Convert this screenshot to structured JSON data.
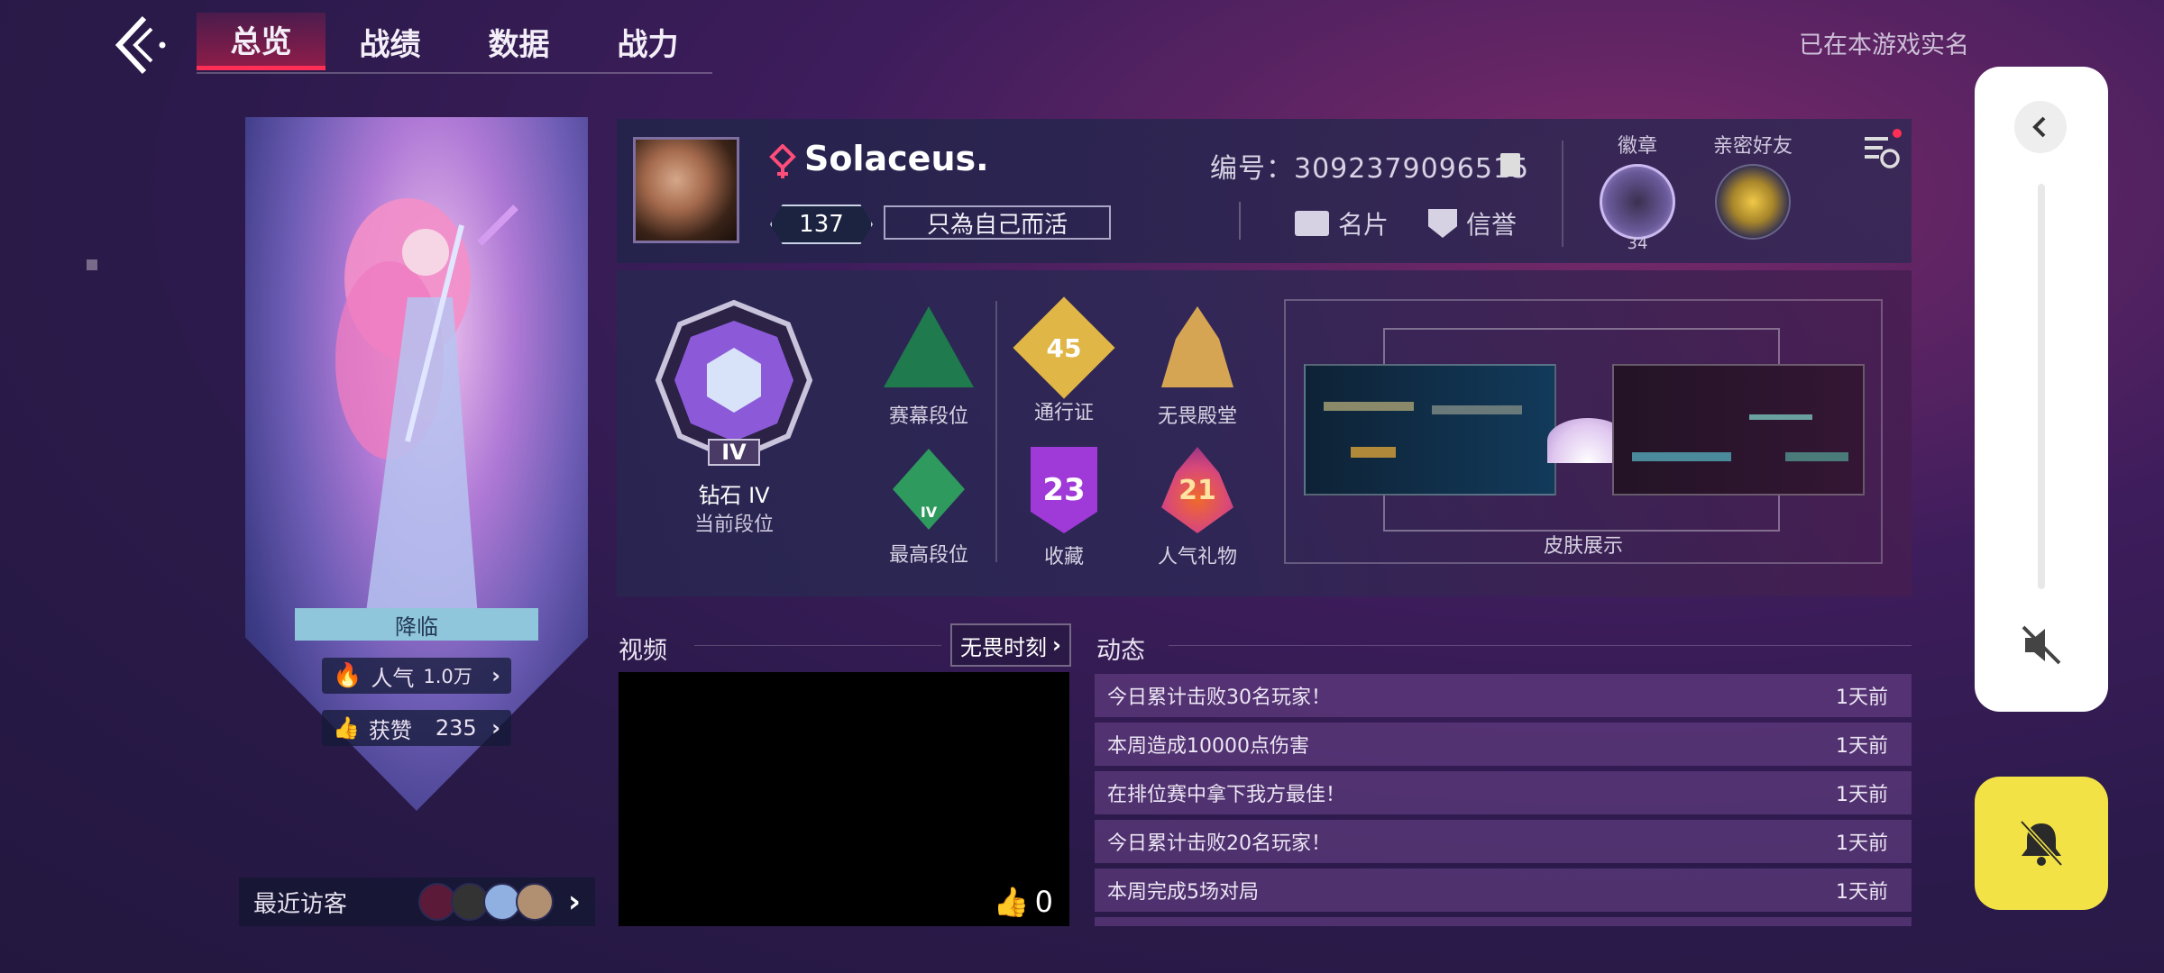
{
  "nav": {
    "tabs": [
      "总览",
      "战绩",
      "数据",
      "战力"
    ],
    "active_tab": 0,
    "realname_text": "已在本游戏实名"
  },
  "hero": {
    "title": "降临",
    "popularity_label": "人气",
    "popularity_value": "1.0万",
    "likes_label": "获赞",
    "likes_value": "235",
    "visitors_label": "最近访客"
  },
  "profile": {
    "name": "Solaceus.",
    "level": "137",
    "motto": "只為自己而活",
    "id_text": "编号：3092379096515",
    "card_label": "名片",
    "credit_label": "信誉",
    "badge_label": "徽章",
    "badge_count": "34",
    "friend_label": "亲密好友"
  },
  "ranks": {
    "current_rank": "钻石 IV",
    "current_rank_caption": "当前段位",
    "current_rank_numeral": "IV",
    "items": [
      {
        "label": "赛幕段位"
      },
      {
        "label": "通行证",
        "value": "45"
      },
      {
        "label": "无畏殿堂"
      },
      {
        "label": "最高段位",
        "value": "IV"
      },
      {
        "label": "收藏",
        "value": "23"
      },
      {
        "label": "人气礼物",
        "value": "21"
      }
    ],
    "skins_label": "皮肤展示"
  },
  "video": {
    "section_label": "视频",
    "more_label": "无畏时刻",
    "likes": "0"
  },
  "feed": {
    "section_label": "动态",
    "items": [
      {
        "text": "今日累计击败30名玩家！",
        "time": "1天前"
      },
      {
        "text": "本周造成10000点伤害",
        "time": "1天前"
      },
      {
        "text": "在排位赛中拿下我方最佳！",
        "time": "1天前"
      },
      {
        "text": "今日累计击败20名玩家！",
        "time": "1天前"
      },
      {
        "text": "本周完成5场对局",
        "time": "1天前"
      }
    ]
  },
  "colors": {
    "accent_red": "#ff2f55",
    "bell_yellow": "#f2e246",
    "feed_row": "#6e468c"
  }
}
